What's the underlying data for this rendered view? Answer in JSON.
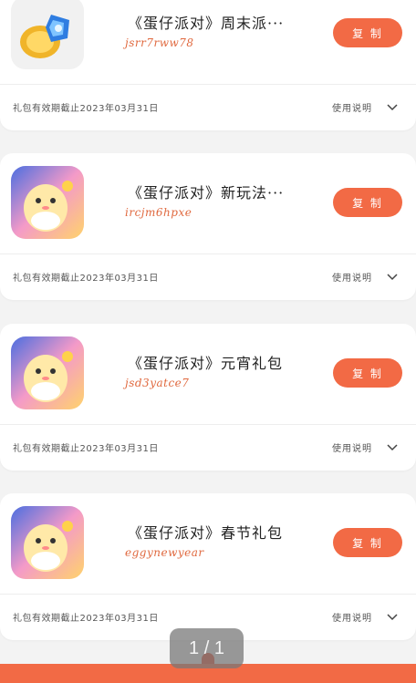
{
  "cards": [
    {
      "icon": "coin-crystal-app-icon",
      "title": "《蛋仔派对》周末派···",
      "code": "jsrr7rww78",
      "claim_label": "复 制",
      "validity": "礼包有效期截止2023年03月31日",
      "usage_label": "使用说明"
    },
    {
      "icon": "eggy-party-app-icon",
      "title": "《蛋仔派对》新玩法···",
      "code": "ircjm6hpxe",
      "claim_label": "复 制",
      "validity": "礼包有效期截止2023年03月31日",
      "usage_label": "使用说明"
    },
    {
      "icon": "eggy-party-app-icon",
      "title": "《蛋仔派对》元宵礼包",
      "code": "jsd3yatce7",
      "claim_label": "复 制",
      "validity": "礼包有效期截止2023年03月31日",
      "usage_label": "使用说明"
    },
    {
      "icon": "eggy-party-app-icon",
      "title": "《蛋仔派对》春节礼包",
      "code": "eggynewyear",
      "claim_label": "复 制",
      "validity": "礼包有效期截止2023年03月31日",
      "usage_label": "使用说明"
    }
  ],
  "pager": {
    "text": "1 / 1"
  },
  "colors": {
    "accent": "#f26a45",
    "code_text": "#e0693f"
  }
}
